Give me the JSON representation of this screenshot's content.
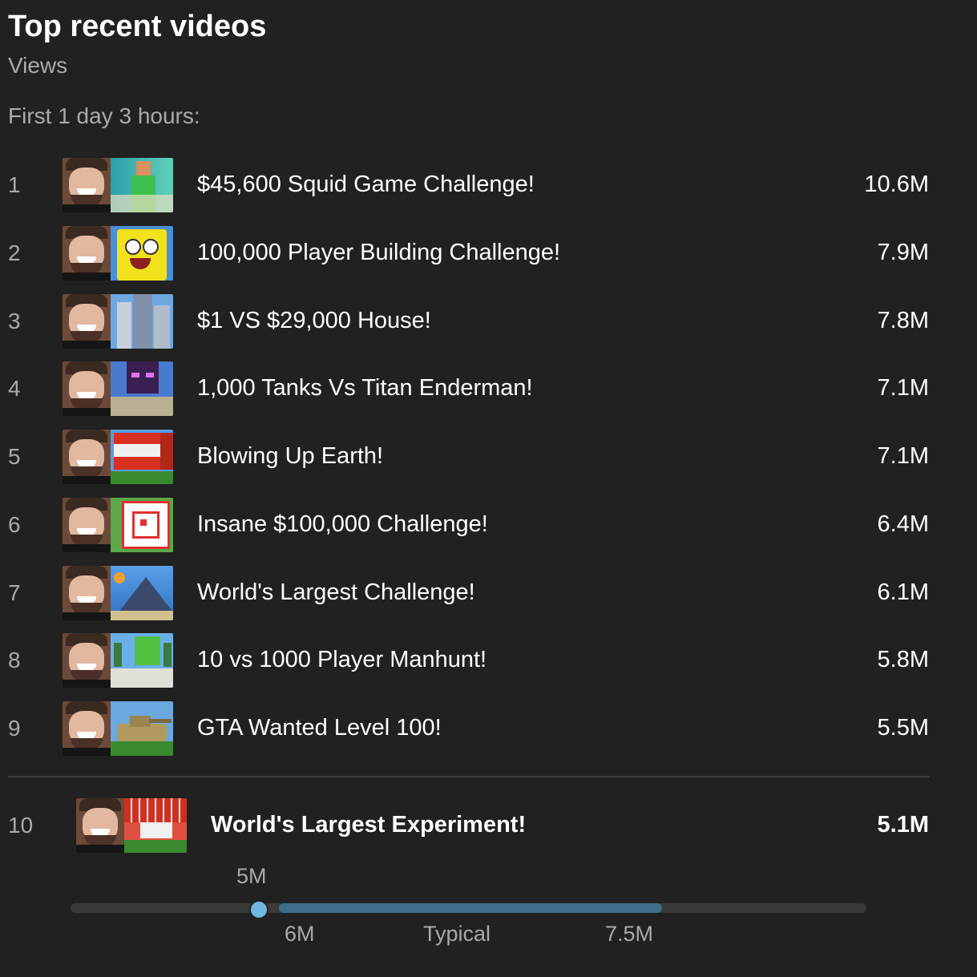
{
  "header": {
    "title": "Top recent videos",
    "metric": "Views",
    "period": "First 1 day 3 hours:"
  },
  "videos": [
    {
      "rank": "1",
      "title": "$45,600 Squid Game Challenge!",
      "views": "10.6M",
      "thumb": "squid-game"
    },
    {
      "rank": "2",
      "title": "100,000 Player Building Challenge!",
      "views": "7.9M",
      "thumb": "spongebob"
    },
    {
      "rank": "3",
      "title": "$1 VS $29,000 House!",
      "views": "7.8M",
      "thumb": "house"
    },
    {
      "rank": "4",
      "title": "1,000 Tanks Vs Titan Enderman!",
      "views": "7.1M",
      "thumb": "enderman"
    },
    {
      "rank": "5",
      "title": "Blowing Up Earth!",
      "views": "7.1M",
      "thumb": "tnt"
    },
    {
      "rank": "6",
      "title": "Insane $100,000 Challenge!",
      "views": "6.4M",
      "thumb": "target"
    },
    {
      "rank": "7",
      "title": "World's Largest Challenge!",
      "views": "6.1M",
      "thumb": "crowd"
    },
    {
      "rank": "8",
      "title": "10 vs 1000 Player Manhunt!",
      "views": "5.8M",
      "thumb": "manhunt"
    },
    {
      "rank": "9",
      "title": "GTA Wanted Level 100!",
      "views": "5.5M",
      "thumb": "tank"
    }
  ],
  "highlighted": {
    "rank": "10",
    "title": "World's Largest Experiment!",
    "views": "5.1M",
    "thumb": "tnt-field"
  },
  "typical_range": {
    "current_label": "5M",
    "low_label": "6M",
    "mid_label": "Typical",
    "high_label": "7.5M",
    "current_value": 5.1,
    "low_value": 6.0,
    "high_value": 7.5
  },
  "colors": {
    "background": "#212121",
    "range_fill": "#3f6d8a",
    "marker": "#6fb6e0"
  }
}
